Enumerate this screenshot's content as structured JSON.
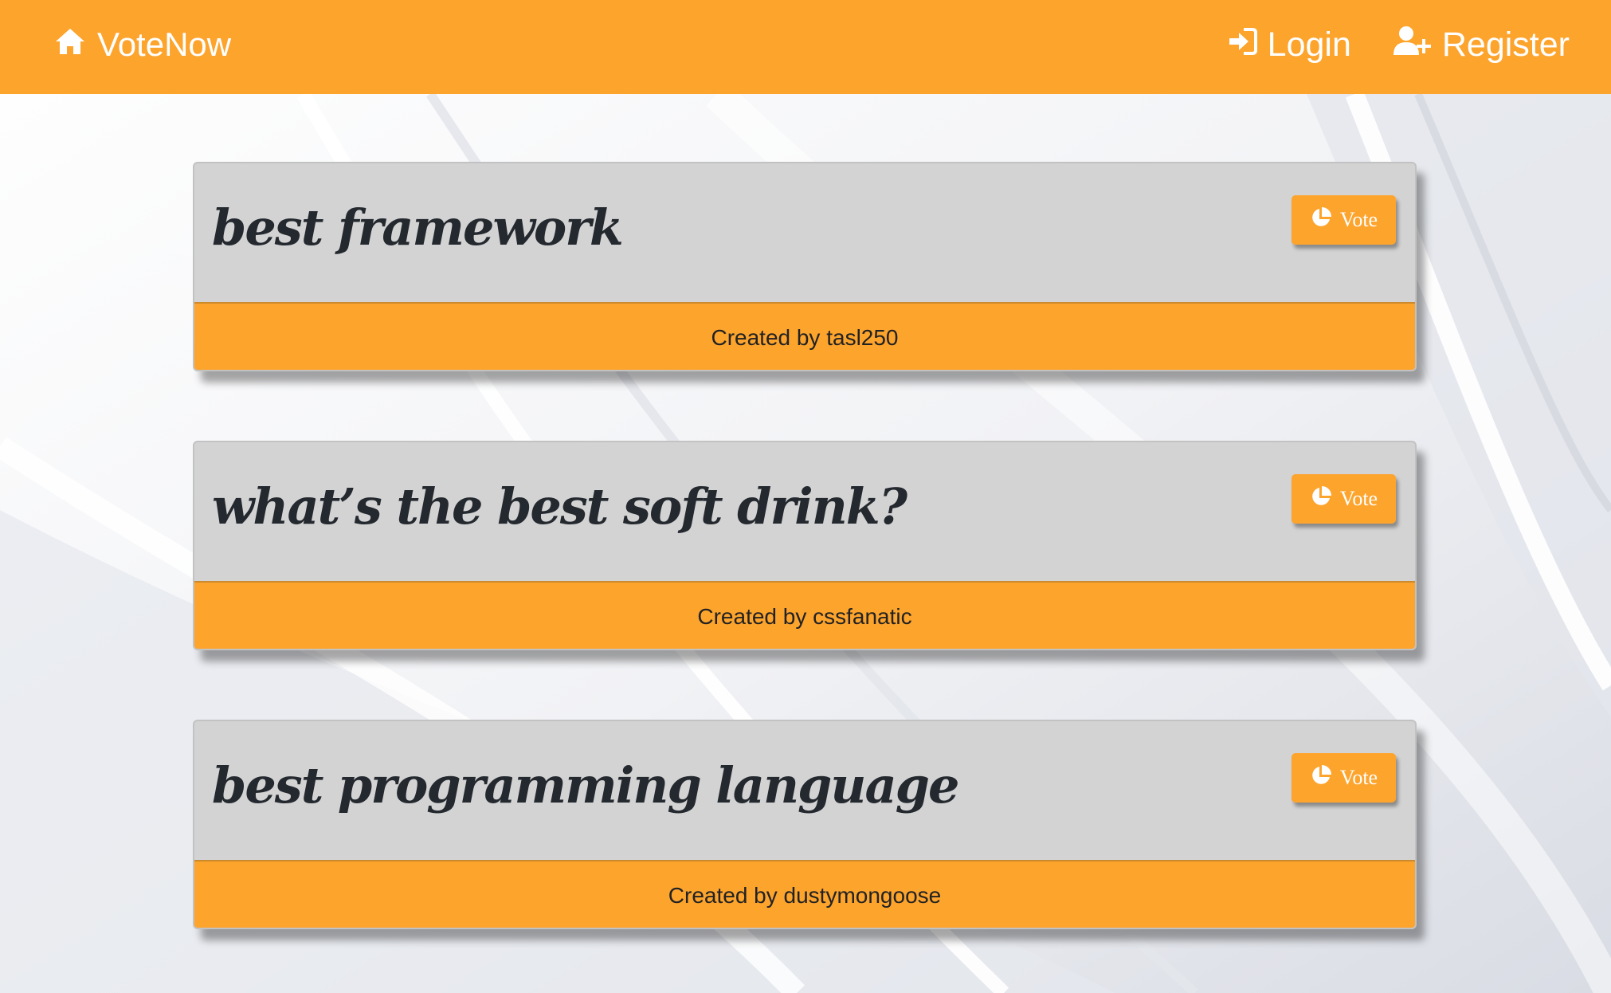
{
  "navbar": {
    "brand": "VoteNow",
    "login": "Login",
    "register": "Register"
  },
  "colors": {
    "accent": "#fda42d",
    "card_head": "#d3d3d3",
    "title_text": "#24292f"
  },
  "icons": {
    "brand": "home-icon",
    "login": "sign-in-icon",
    "register": "user-plus-icon",
    "vote": "pie-chart-icon"
  },
  "polls": [
    {
      "title": "best framework",
      "vote_label": "Vote",
      "created_prefix": "Created by",
      "author": "tasl250"
    },
    {
      "title": "what’s the best soft drink?",
      "vote_label": "Vote",
      "created_prefix": "Created by",
      "author": "cssfanatic"
    },
    {
      "title": "best programming language",
      "vote_label": "Vote",
      "created_prefix": "Created by",
      "author": "dustymongoose"
    }
  ]
}
